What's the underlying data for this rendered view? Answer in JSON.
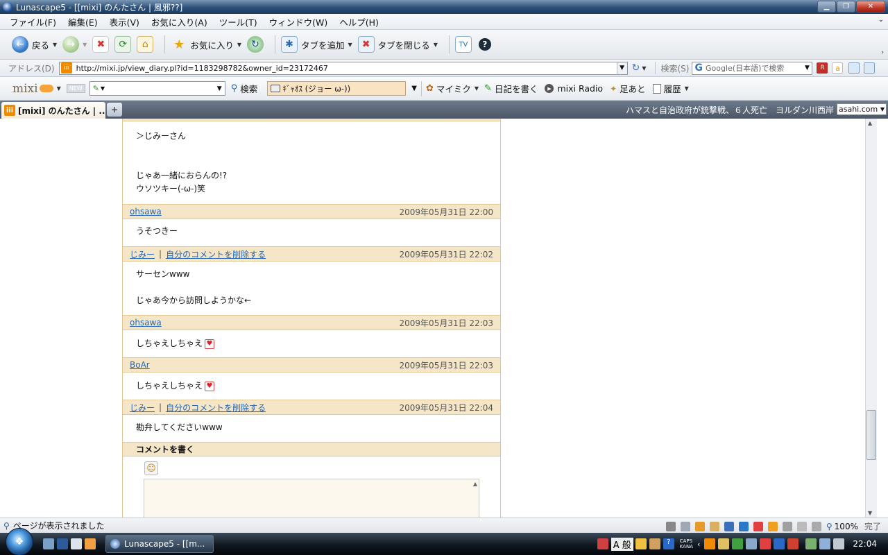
{
  "window": {
    "title": "Lunascape5 - [[mixi] のんたさん | 風邪??]"
  },
  "menu": [
    "ファイル(F)",
    "編集(E)",
    "表示(V)",
    "お気に入り(A)",
    "ツール(T)",
    "ウィンドウ(W)",
    "ヘルプ(H)"
  ],
  "toolbar": {
    "back": "戻る",
    "favorites": "お気に入り",
    "add_tab": "タブを追加",
    "close_tab": "タブを閉じる"
  },
  "address": {
    "label": "アドレス(D)",
    "url": "http://mixi.jp/view_diary.pl?id=1183298782&owner_id=23172467",
    "search_label": "検索(S)",
    "search_placeholder": "Google(日本語)で検索"
  },
  "mixibar": {
    "logo": "mixi",
    "new_badge": "NEW",
    "search": "検索",
    "status": "ｷﾞｬｵｽ (ジョー ω-))",
    "mymixi": "マイミク",
    "diary": "日記を書く",
    "radio": "mixi Radio",
    "footprints": "足あと",
    "history": "履歴"
  },
  "tabs": {
    "active": "[mixi] のんたさん | ...",
    "news": "ハマスと自治政府が銃撃戦、６人死亡　ヨルダン川西岸",
    "news_source": "asahi.com"
  },
  "comments": [
    {
      "body": [
        "＞じみーさん",
        "",
        "",
        "じゃあ一緒におらんの!?",
        "ウソツキー(-ω-)笑"
      ]
    },
    {
      "author": "ohsawa",
      "delete": "",
      "date": "2009年05月31日  22:00",
      "body": [
        "うそつきー"
      ]
    },
    {
      "author": "じみー",
      "delete": "自分のコメントを削除する",
      "date": "2009年05月31日  22:02",
      "body": [
        "サーセンwww",
        "",
        "じゃあ今から訪問しようかな←"
      ]
    },
    {
      "author": "ohsawa",
      "delete": "",
      "date": "2009年05月31日  22:03",
      "body": [
        "しちゃえしちゃえ"
      ],
      "heart": true
    },
    {
      "author": "BoAr",
      "delete": "",
      "date": "2009年05月31日  22:03",
      "body": [
        "しちゃえしちゃえ"
      ],
      "heart": true
    },
    {
      "author": "じみー",
      "delete": "自分のコメントを削除する",
      "date": "2009年05月31日  22:04",
      "body": [
        "勘弁してくださいwww"
      ]
    }
  ],
  "comment_form": {
    "title": "コメントを書く"
  },
  "status": {
    "text": "ページが表示されました",
    "zoom": "100%",
    "done": "完了"
  },
  "taskbar": {
    "window": "Lunascape5 - [[m...",
    "ime": "A 般",
    "caps": "CAPS",
    "kana": "KANA",
    "clock": "22:04"
  }
}
